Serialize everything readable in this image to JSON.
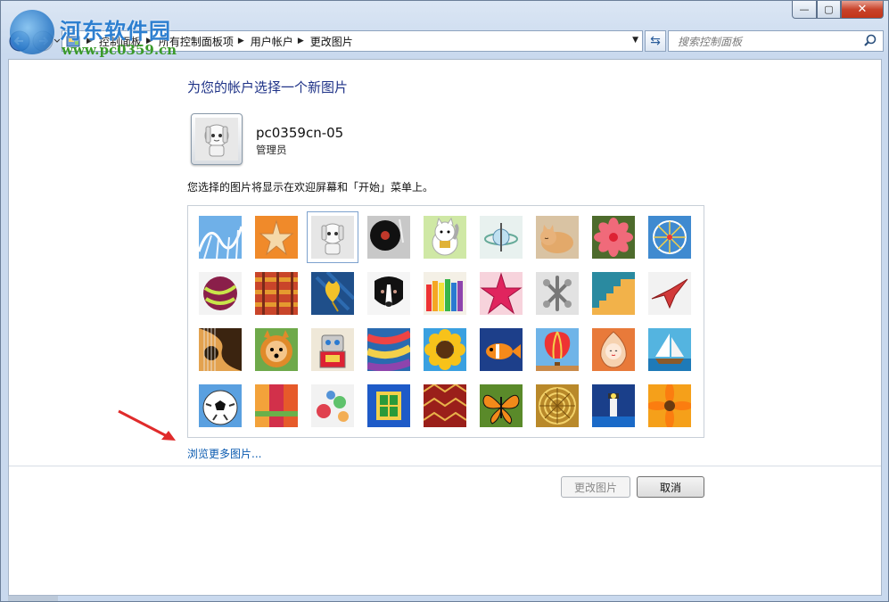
{
  "watermark": {
    "title": "河东软件园",
    "url": "www.pc0359.cn"
  },
  "window": {
    "close_label": "✕",
    "min_label": "—",
    "max_label": "▢"
  },
  "breadcrumb": [
    "控制面板",
    "所有控制面板项",
    "用户帐户",
    "更改图片"
  ],
  "search": {
    "placeholder": "搜索控制面板"
  },
  "page": {
    "heading": "为您的帐户选择一个新图片",
    "username": "pc0359cn-05",
    "role": "管理员",
    "description": "您选择的图片将显示在欢迎屏幕和「开始」菜单上。",
    "browse_link": "浏览更多图片...",
    "change_button": "更改图片",
    "cancel_button": "取消"
  },
  "pictures": [
    "roller-coaster",
    "starfish",
    "robot-toy",
    "record-player",
    "lucky-cat",
    "spinning-top",
    "sleeping-kitten",
    "pink-flower",
    "ferris-wheel",
    "striped-ball",
    "woven-fabric",
    "ginkgo-leaf",
    "border-collie",
    "crayons",
    "red-paper-star",
    "jacks",
    "stairs",
    "origami-crane",
    "guitar",
    "pomeranian",
    "tin-robot",
    "scarves",
    "sunflower",
    "tropical-fish",
    "hot-air-balloon",
    "doll-charm",
    "sailboat",
    "soccer-ball",
    "silk-fabric",
    "marbles",
    "green-window",
    "carpet-pattern",
    "butterfly",
    "basket-weave",
    "lighthouse",
    "orange-daisy"
  ],
  "selected_picture": "robot-toy"
}
